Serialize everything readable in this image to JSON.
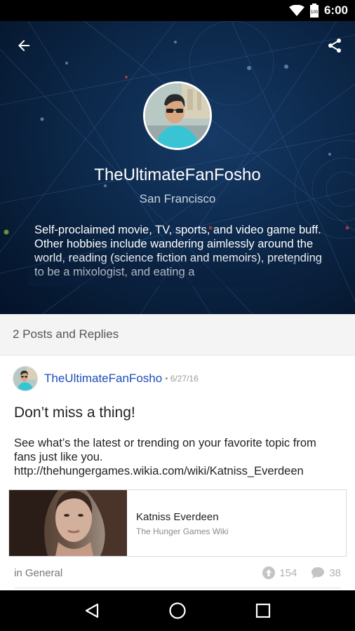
{
  "status_bar": {
    "time": "6:00",
    "battery_level": "100"
  },
  "profile": {
    "username": "TheUltimateFanFosho",
    "location": "San Francisco",
    "bio": "Self-proclaimed movie, TV, sports, and video game buff. Other hobbies include wandering aimlessly around the world, reading (science fiction and memoirs), pretending to be a mixologist, and eating a"
  },
  "section": {
    "title": "2 Posts and Replies"
  },
  "post": {
    "author": "TheUltimateFanFosho",
    "date": "• 6/27/16",
    "title": "Don’t miss a thing!",
    "body": "See what’s the latest or trending on your favorite topic from fans just like you. http://thehungergames.wikia.com/wiki/Katniss_Everdeen",
    "card": {
      "title": "Katniss Everdeen",
      "subtitle": "The Hunger Games Wiki"
    },
    "category": "in General",
    "upvotes": "154",
    "comments": "38"
  },
  "icons": {
    "back": "arrow-left-icon",
    "share": "share-icon",
    "upvote": "upvote-icon",
    "comment": "comment-icon",
    "nav_back": "triangle-back-icon",
    "nav_home": "circle-home-icon",
    "nav_recents": "square-recents-icon"
  },
  "colors": {
    "author_link": "#1b4fb8",
    "hero_bg": "#0d2a4d",
    "nav_bar": "#000000"
  }
}
